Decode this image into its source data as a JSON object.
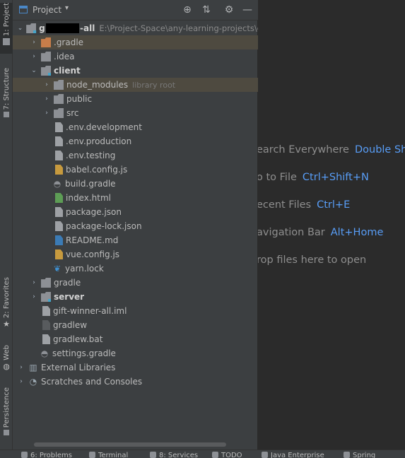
{
  "left_strip": {
    "project_tab": "1: Project",
    "structure_tab": "7: Structure",
    "favorites_tab": "2: Favorites",
    "web_tab": "Web",
    "persistence_tab": "Persistence"
  },
  "panel": {
    "title": "Project",
    "dropdown_glyph": "▾",
    "locate_glyph": "⊕",
    "collapse_glyph": "⇅",
    "settings_glyph": "⚙",
    "hide_glyph": "—"
  },
  "tree": {
    "root": {
      "name_prefix": "g",
      "name_suffix": "-all",
      "path": "E:\\Project-Space\\any-learning-projects\\g"
    },
    "gradle_dir": ".gradle",
    "idea_dir": ".idea",
    "client": "client",
    "node_modules": "node_modules",
    "node_modules_note": "library root",
    "public": "public",
    "src": "src",
    "env_development": ".env.development",
    "env_production": ".env.production",
    "env_testing": ".env.testing",
    "babel_config": "babel.config.js",
    "build_gradle": "build.gradle",
    "index_html": "index.html",
    "package_json": "package.json",
    "package_lock": "package-lock.json",
    "readme": "README.md",
    "vue_config": "vue.config.js",
    "yarn_lock": "yarn.lock",
    "gradle": "gradle",
    "server": "server",
    "iml": "gift-winner-all.iml",
    "gradlew": "gradlew",
    "gradlew_bat": "gradlew.bat",
    "settings_gradle": "settings.gradle",
    "external_libraries": "External Libraries",
    "scratches": "Scratches and Consoles"
  },
  "editor_hints": [
    {
      "text": "earch Everywhere",
      "shortcut": "Double Shift"
    },
    {
      "text": "o to File",
      "shortcut": "Ctrl+Shift+N"
    },
    {
      "text": "ecent Files",
      "shortcut": "Ctrl+E"
    },
    {
      "text": "avigation Bar",
      "shortcut": "Alt+Home"
    },
    {
      "text": "rop files here to open",
      "shortcut": ""
    }
  ],
  "bottom_bar": {
    "problems": "6: Problems",
    "terminal": "Terminal",
    "services": "8: Services",
    "todo": "TODO",
    "java_enterprise": "Java Enterprise",
    "spring": "Spring"
  },
  "colors": {
    "panel_bg": "#3c3f41",
    "editor_bg": "#2b2b2b",
    "shortcut": "#589df6",
    "highlight_row": "#4e4a40"
  }
}
